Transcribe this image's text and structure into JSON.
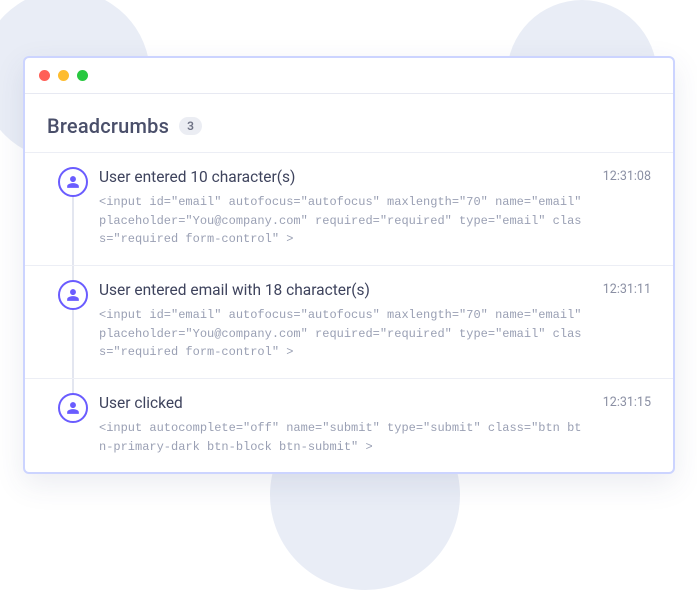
{
  "header": {
    "title": "Breadcrumbs",
    "count": "3"
  },
  "events": [
    {
      "title": "User entered 10 character(s)",
      "detail": "<input id=\"email\" autofocus=\"autofocus\" maxlength=\"70\" name=\"email\" placeholder=\"You@company.com\" required=\"required\" type=\"email\" class=\"required form-control\" >",
      "time": "12:31:08"
    },
    {
      "title": "User entered email with 18 character(s)",
      "detail": "<input id=\"email\" autofocus=\"autofocus\" maxlength=\"70\" name=\"email\" placeholder=\"You@company.com\" required=\"required\" type=\"email\" class=\"required form-control\" >",
      "time": "12:31:11"
    },
    {
      "title": "User clicked",
      "detail": "<input autocomplete=\"off\" name=\"submit\" type=\"submit\" class=\"btn btn-primary-dark btn-block btn-submit\" >",
      "time": "12:31:15"
    }
  ]
}
